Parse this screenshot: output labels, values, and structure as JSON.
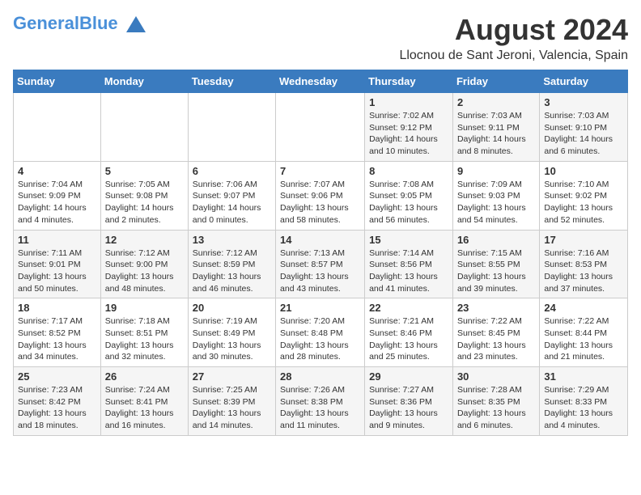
{
  "header": {
    "logo_general": "General",
    "logo_blue": "Blue",
    "title": "August 2024",
    "subtitle": "Llocnou de Sant Jeroni, Valencia, Spain"
  },
  "days_of_week": [
    "Sunday",
    "Monday",
    "Tuesday",
    "Wednesday",
    "Thursday",
    "Friday",
    "Saturday"
  ],
  "weeks": [
    [
      {
        "day": "",
        "info": ""
      },
      {
        "day": "",
        "info": ""
      },
      {
        "day": "",
        "info": ""
      },
      {
        "day": "",
        "info": ""
      },
      {
        "day": "1",
        "info": "Sunrise: 7:02 AM\nSunset: 9:12 PM\nDaylight: 14 hours\nand 10 minutes."
      },
      {
        "day": "2",
        "info": "Sunrise: 7:03 AM\nSunset: 9:11 PM\nDaylight: 14 hours\nand 8 minutes."
      },
      {
        "day": "3",
        "info": "Sunrise: 7:03 AM\nSunset: 9:10 PM\nDaylight: 14 hours\nand 6 minutes."
      }
    ],
    [
      {
        "day": "4",
        "info": "Sunrise: 7:04 AM\nSunset: 9:09 PM\nDaylight: 14 hours\nand 4 minutes."
      },
      {
        "day": "5",
        "info": "Sunrise: 7:05 AM\nSunset: 9:08 PM\nDaylight: 14 hours\nand 2 minutes."
      },
      {
        "day": "6",
        "info": "Sunrise: 7:06 AM\nSunset: 9:07 PM\nDaylight: 14 hours\nand 0 minutes."
      },
      {
        "day": "7",
        "info": "Sunrise: 7:07 AM\nSunset: 9:06 PM\nDaylight: 13 hours\nand 58 minutes."
      },
      {
        "day": "8",
        "info": "Sunrise: 7:08 AM\nSunset: 9:05 PM\nDaylight: 13 hours\nand 56 minutes."
      },
      {
        "day": "9",
        "info": "Sunrise: 7:09 AM\nSunset: 9:03 PM\nDaylight: 13 hours\nand 54 minutes."
      },
      {
        "day": "10",
        "info": "Sunrise: 7:10 AM\nSunset: 9:02 PM\nDaylight: 13 hours\nand 52 minutes."
      }
    ],
    [
      {
        "day": "11",
        "info": "Sunrise: 7:11 AM\nSunset: 9:01 PM\nDaylight: 13 hours\nand 50 minutes."
      },
      {
        "day": "12",
        "info": "Sunrise: 7:12 AM\nSunset: 9:00 PM\nDaylight: 13 hours\nand 48 minutes."
      },
      {
        "day": "13",
        "info": "Sunrise: 7:12 AM\nSunset: 8:59 PM\nDaylight: 13 hours\nand 46 minutes."
      },
      {
        "day": "14",
        "info": "Sunrise: 7:13 AM\nSunset: 8:57 PM\nDaylight: 13 hours\nand 43 minutes."
      },
      {
        "day": "15",
        "info": "Sunrise: 7:14 AM\nSunset: 8:56 PM\nDaylight: 13 hours\nand 41 minutes."
      },
      {
        "day": "16",
        "info": "Sunrise: 7:15 AM\nSunset: 8:55 PM\nDaylight: 13 hours\nand 39 minutes."
      },
      {
        "day": "17",
        "info": "Sunrise: 7:16 AM\nSunset: 8:53 PM\nDaylight: 13 hours\nand 37 minutes."
      }
    ],
    [
      {
        "day": "18",
        "info": "Sunrise: 7:17 AM\nSunset: 8:52 PM\nDaylight: 13 hours\nand 34 minutes."
      },
      {
        "day": "19",
        "info": "Sunrise: 7:18 AM\nSunset: 8:51 PM\nDaylight: 13 hours\nand 32 minutes."
      },
      {
        "day": "20",
        "info": "Sunrise: 7:19 AM\nSunset: 8:49 PM\nDaylight: 13 hours\nand 30 minutes."
      },
      {
        "day": "21",
        "info": "Sunrise: 7:20 AM\nSunset: 8:48 PM\nDaylight: 13 hours\nand 28 minutes."
      },
      {
        "day": "22",
        "info": "Sunrise: 7:21 AM\nSunset: 8:46 PM\nDaylight: 13 hours\nand 25 minutes."
      },
      {
        "day": "23",
        "info": "Sunrise: 7:22 AM\nSunset: 8:45 PM\nDaylight: 13 hours\nand 23 minutes."
      },
      {
        "day": "24",
        "info": "Sunrise: 7:22 AM\nSunset: 8:44 PM\nDaylight: 13 hours\nand 21 minutes."
      }
    ],
    [
      {
        "day": "25",
        "info": "Sunrise: 7:23 AM\nSunset: 8:42 PM\nDaylight: 13 hours\nand 18 minutes."
      },
      {
        "day": "26",
        "info": "Sunrise: 7:24 AM\nSunset: 8:41 PM\nDaylight: 13 hours\nand 16 minutes."
      },
      {
        "day": "27",
        "info": "Sunrise: 7:25 AM\nSunset: 8:39 PM\nDaylight: 13 hours\nand 14 minutes."
      },
      {
        "day": "28",
        "info": "Sunrise: 7:26 AM\nSunset: 8:38 PM\nDaylight: 13 hours\nand 11 minutes."
      },
      {
        "day": "29",
        "info": "Sunrise: 7:27 AM\nSunset: 8:36 PM\nDaylight: 13 hours\nand 9 minutes."
      },
      {
        "day": "30",
        "info": "Sunrise: 7:28 AM\nSunset: 8:35 PM\nDaylight: 13 hours\nand 6 minutes."
      },
      {
        "day": "31",
        "info": "Sunrise: 7:29 AM\nSunset: 8:33 PM\nDaylight: 13 hours\nand 4 minutes."
      }
    ]
  ]
}
